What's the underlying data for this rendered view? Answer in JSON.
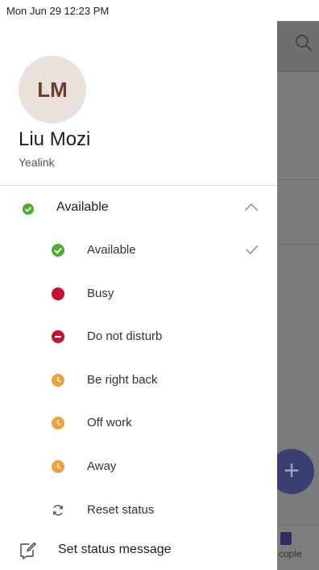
{
  "status_bar": {
    "datetime": "Mon Jun 29  12:23 PM"
  },
  "profile": {
    "initials": "LM",
    "name": "Liu Mozi",
    "organization": "Yealink"
  },
  "current_status": {
    "label": "Available",
    "icon": "green-check-icon",
    "expanded": true
  },
  "status_options": [
    {
      "label": "Available",
      "icon": "available-icon",
      "color": "#4caf2a",
      "selected": true
    },
    {
      "label": "Busy",
      "icon": "busy-icon",
      "color": "#c8102e",
      "selected": false
    },
    {
      "label": "Do not disturb",
      "icon": "do-not-disturb-icon",
      "color": "#c8102e",
      "selected": false
    },
    {
      "label": "Be right back",
      "icon": "clock-icon",
      "color": "#f0a23a",
      "selected": false
    },
    {
      "label": "Off work",
      "icon": "clock-icon",
      "color": "#f0a23a",
      "selected": false
    },
    {
      "label": "Away",
      "icon": "clock-icon",
      "color": "#f0a23a",
      "selected": false
    }
  ],
  "reset_status": {
    "label": "Reset status",
    "icon": "reset-icon"
  },
  "set_status_message": {
    "label": "Set status message",
    "icon": "edit-note-icon"
  },
  "background": {
    "tab_label": "cople",
    "fab_symbol": "+"
  }
}
